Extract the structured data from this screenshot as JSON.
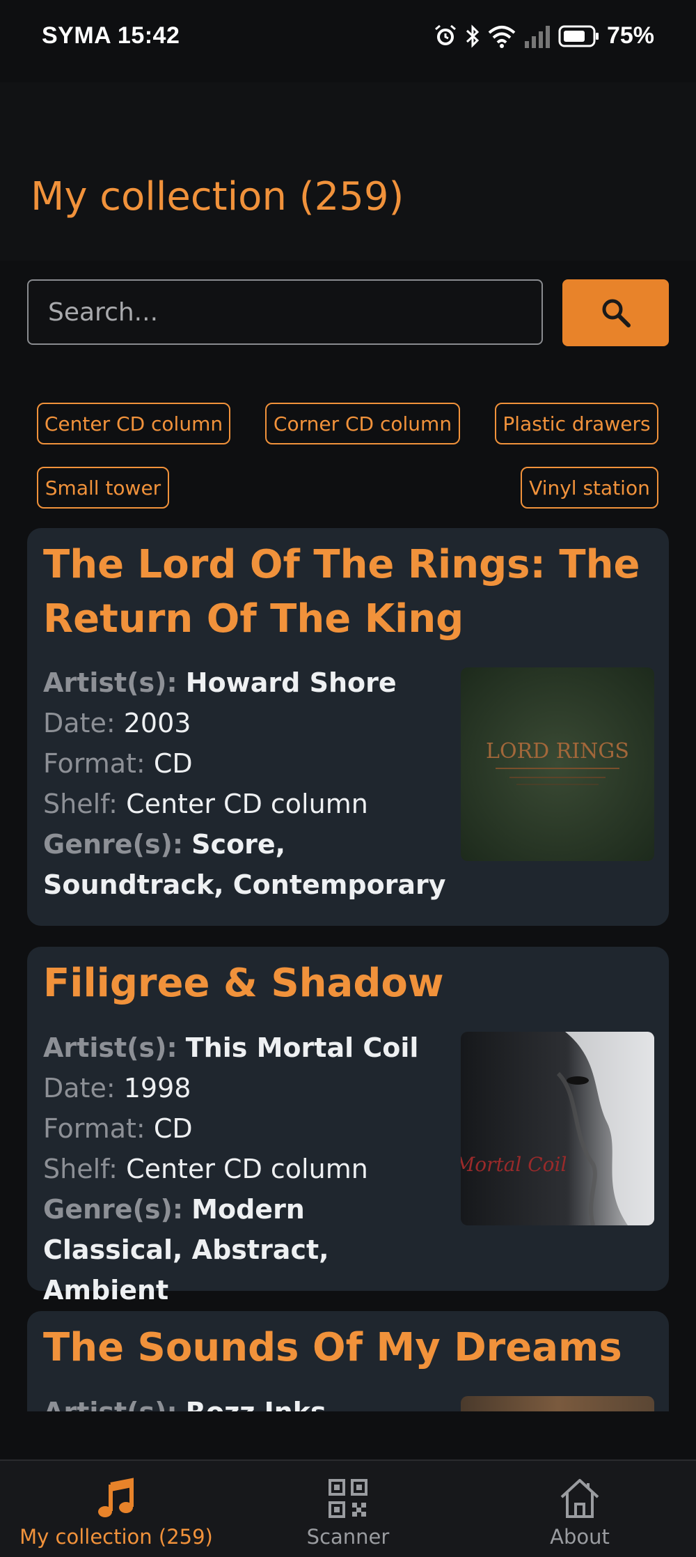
{
  "status_bar": {
    "carrier_time": "SYMA 15:42",
    "battery": "75%",
    "icons": [
      "alarm-icon",
      "bluetooth-icon",
      "wifi-icon",
      "signal-icon",
      "battery-icon"
    ]
  },
  "header": {
    "title": "My collection (259)"
  },
  "search": {
    "placeholder": "Search...",
    "value": "",
    "button_icon": "search-icon"
  },
  "shelves": [
    "Center CD column",
    "Corner CD column",
    "Plastic drawers",
    "Small tower",
    "Vinyl station"
  ],
  "labels": {
    "artists": "Artist(s):",
    "date": "Date:",
    "format": "Format:",
    "shelf": "Shelf:",
    "genres": "Genre(s):"
  },
  "albums": [
    {
      "title": "The Lord Of The Rings: The Return Of The King",
      "artist": "Howard Shore",
      "date": "2003",
      "format": "CD",
      "shelf": "Center CD column",
      "genres": "Score, Soundtrack, Contemporary",
      "cover_text": "LORD RINGS"
    },
    {
      "title": "Filigree & Shadow",
      "artist": "This Mortal Coil",
      "date": "1998",
      "format": "CD",
      "shelf": "Center CD column",
      "genres": "Modern Classical, Abstract, Ambient",
      "cover_text": "Mortal Coil"
    },
    {
      "title": "The Sounds Of My Dreams",
      "artist": "Rozz Inks"
    }
  ],
  "nav": [
    {
      "label": "My collection (259)",
      "icon": "music-note-icon",
      "active": true
    },
    {
      "label": "Scanner",
      "icon": "qr-code-icon",
      "active": false
    },
    {
      "label": "About",
      "icon": "home-icon",
      "active": false
    }
  ],
  "colors": {
    "accent": "#f1923b",
    "button": "#e8832a",
    "card_bg": "#1f262e",
    "background": "#0e0f11"
  }
}
